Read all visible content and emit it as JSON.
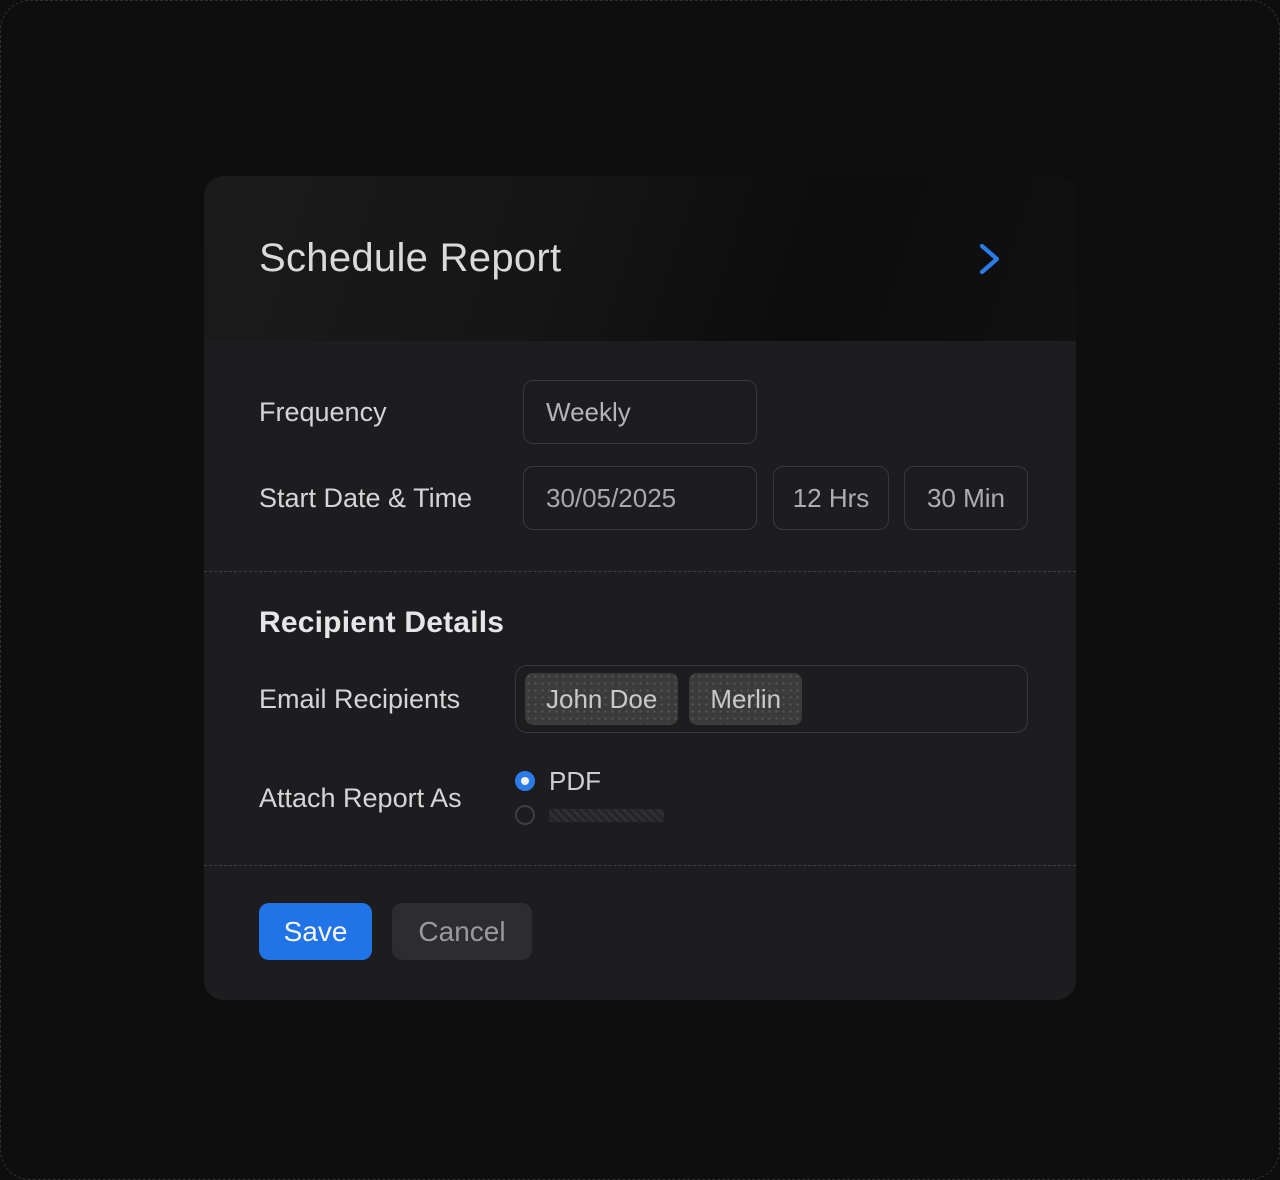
{
  "dialog": {
    "title": "Schedule Report"
  },
  "schedule": {
    "frequency": {
      "label": "Frequency",
      "value": "Weekly"
    },
    "start": {
      "label": "Start Date & Time",
      "date": "30/05/2025",
      "hours": "12 Hrs",
      "minutes": "30 Min"
    }
  },
  "recipients": {
    "heading": "Recipient Details",
    "email": {
      "label": "Email Recipients",
      "chips": [
        "John Doe",
        "Merlin"
      ]
    },
    "attach": {
      "label": "Attach Report As",
      "options": [
        {
          "label": "PDF",
          "selected": true
        },
        {
          "label": "",
          "selected": false
        }
      ]
    }
  },
  "footer": {
    "save": "Save",
    "cancel": "Cancel"
  },
  "icons": {
    "header_chevron": "chevron-right-icon"
  },
  "colors": {
    "page_bg": "#0e0e0f",
    "panel_bg": "#1d1d1f",
    "accent_blue": "#2b7ce9",
    "save_blue": "#2173e8"
  }
}
